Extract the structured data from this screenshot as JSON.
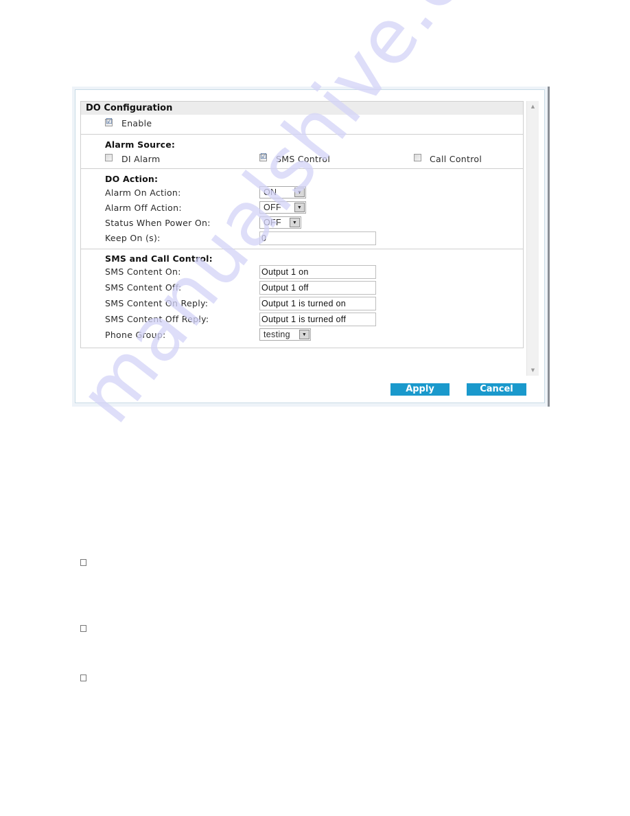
{
  "panel": {
    "title": "DO Configuration",
    "enable": {
      "label": "Enable",
      "checked": true
    }
  },
  "alarm_source": {
    "title": "Alarm Source:",
    "options": [
      {
        "label": "DI Alarm",
        "checked": false
      },
      {
        "label": "SMS Control",
        "checked": true
      },
      {
        "label": "Call Control",
        "checked": false
      }
    ]
  },
  "do_action": {
    "title": "DO Action:",
    "alarm_on_action": {
      "label": "Alarm On Action:",
      "value": "ON"
    },
    "alarm_off_action": {
      "label": "Alarm Off Action:",
      "value": "OFF"
    },
    "status_power_on": {
      "label": "Status When Power On:",
      "value": "OFF"
    },
    "keep_on": {
      "label": "Keep On (s):",
      "value": "0"
    }
  },
  "sms_call": {
    "title": "SMS and Call Control:",
    "content_on": {
      "label": "SMS Content On:",
      "value": "Output 1 on"
    },
    "content_off": {
      "label": "SMS Content Off:",
      "value": "Output 1 off"
    },
    "content_on_reply": {
      "label": "SMS Content On Reply:",
      "value": "Output 1 is turned on"
    },
    "content_off_reply": {
      "label": "SMS Content Off Reply:",
      "value": "Output 1 is turned off"
    },
    "phone_group": {
      "label": "Phone Group:",
      "value": "testing"
    }
  },
  "buttons": {
    "apply": "Apply",
    "cancel": "Cancel"
  },
  "icons": {
    "checked": "☑",
    "dropdown": "▼",
    "scroll_up": "▲",
    "scroll_down": "▼"
  },
  "watermark": "manualshive.com",
  "colors": {
    "button_bg": "#1a99cc",
    "header_bg": "#ececec"
  }
}
